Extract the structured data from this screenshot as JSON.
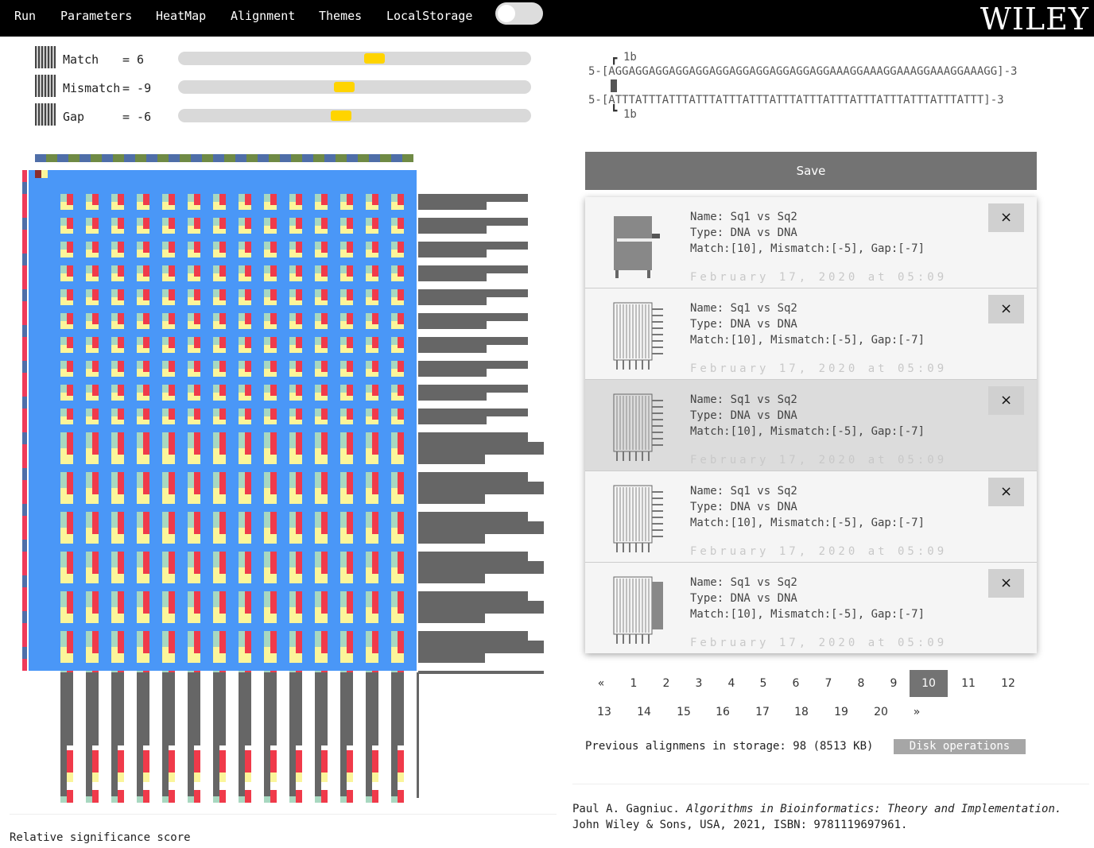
{
  "nav": {
    "run": "Run",
    "parameters": "Parameters",
    "heatmap": "HeatMap",
    "alignment": "Alignment",
    "themes": "Themes",
    "localstorage": "LocalStorage",
    "brand": "WILEY"
  },
  "params": [
    {
      "label": "Match",
      "eq": "= 6",
      "slider_fraction": 0.56
    },
    {
      "label": "Mismatch",
      "eq": "= -9",
      "slider_fraction": 0.47
    },
    {
      "label": "Gap",
      "eq": "= -6",
      "slider_fraction": 0.46
    }
  ],
  "alignment": {
    "top_marker": "1b",
    "seq1": "5-[AGGAGGAGGAGGAGGAGGAGGAGGAGGAGGAGGAAAGGAAAGGAAAGGAAAGGAAAGG]-3",
    "seq2": "5-[ATTTATTTATTTATTTATTTATTTATTTATTTATTTATTTATTTATTTATTTATTT]-3",
    "bottom_marker": "1b"
  },
  "save_label": "Save",
  "entries": [
    {
      "name": "Name: Sq1 vs Sq2",
      "type": "Type: DNA vs DNA",
      "scores": "Match:[10], Mismatch:[-5], Gap:[-7]",
      "date": "February 17, 2020 at 05:09",
      "close": "×"
    },
    {
      "name": "Name: Sq1 vs Sq2",
      "type": "Type: DNA vs DNA",
      "scores": "Match:[10], Mismatch:[-5], Gap:[-7]",
      "date": "February 17, 2020 at 05:09",
      "close": "×"
    },
    {
      "name": "Name: Sq1 vs Sq2",
      "type": "Type: DNA vs DNA",
      "scores": "Match:[10], Mismatch:[-5], Gap:[-7]",
      "date": "February 17, 2020 at 05:09",
      "close": "×"
    },
    {
      "name": "Name: Sq1 vs Sq2",
      "type": "Type: DNA vs DNA",
      "scores": "Match:[10], Mismatch:[-5], Gap:[-7]",
      "date": "February 17, 2020 at 05:09",
      "close": "×"
    },
    {
      "name": "Name: Sq1 vs Sq2",
      "type": "Type: DNA vs DNA",
      "scores": "Match:[10], Mismatch:[-5], Gap:[-7]",
      "date": "February 17, 2020 at 05:09",
      "close": "×"
    }
  ],
  "pagination": {
    "row1": [
      "«",
      "1",
      "2",
      "3",
      "4",
      "5",
      "6",
      "7",
      "8",
      "9",
      "10",
      "11",
      "12"
    ],
    "row2": [
      "13",
      "14",
      "15",
      "16",
      "17",
      "18",
      "19",
      "20",
      "»"
    ],
    "active": "10"
  },
  "storage": {
    "text": "Previous alignmens in storage: 98 (8513 KB)",
    "disk_button": "Disk operations"
  },
  "citation": {
    "author": "Paul A. Gagniuc. ",
    "title": "Algorithms in Bioinformatics: Theory and Implementation.",
    "line2": "John Wiley & Sons, USA, 2021, ISBN: 9781119697961."
  },
  "score_label": "Relative significance score",
  "colors": {
    "matrix_bg": "#4a97f7",
    "match": "#f03a4a",
    "cell_light": "#fbf59a",
    "cell_teal": "#a8d8c0",
    "bars": "#666666",
    "slider_knob": "#ffd400"
  }
}
